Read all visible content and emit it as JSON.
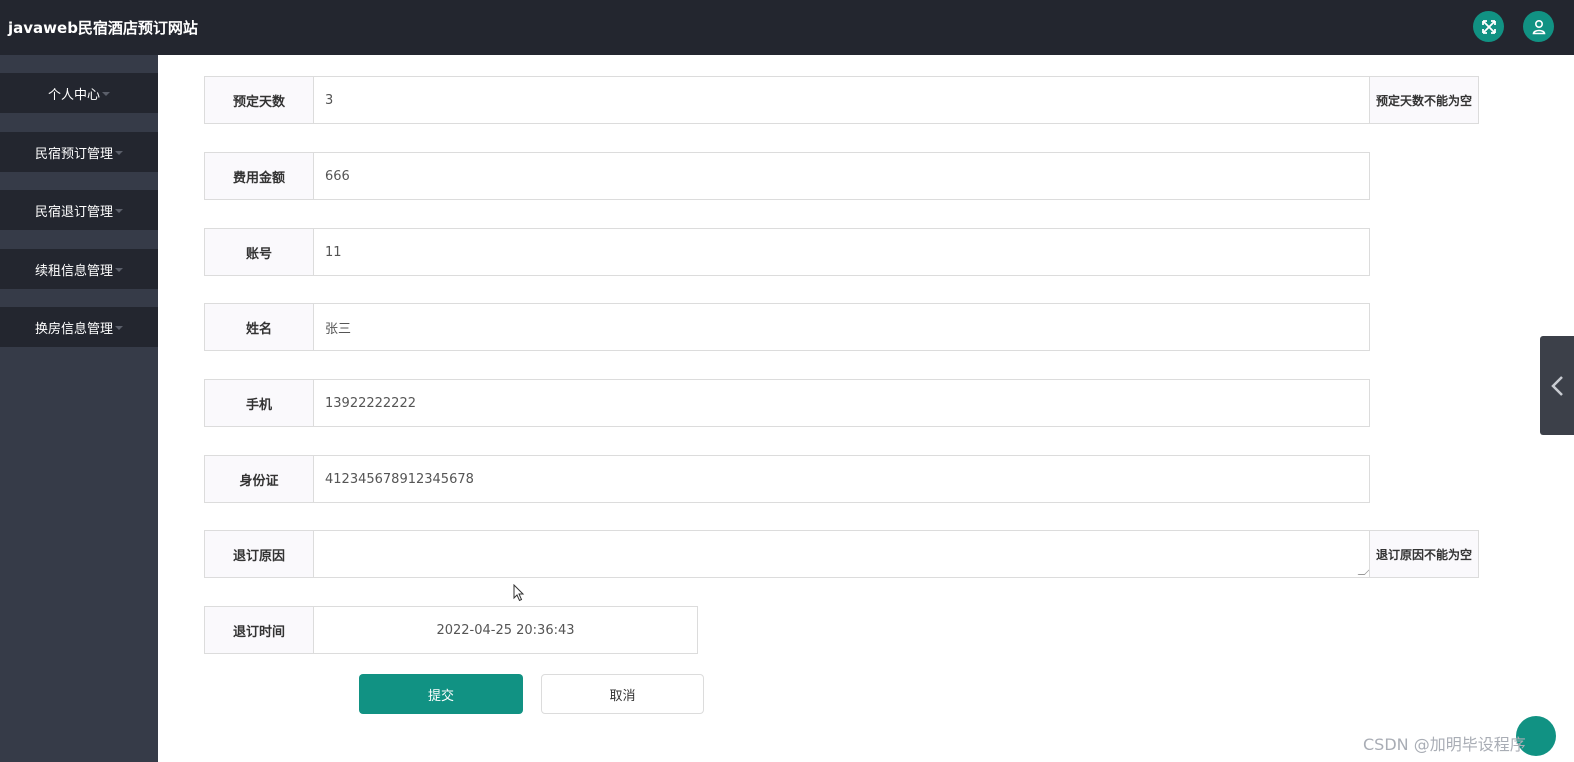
{
  "header": {
    "title": "javaweb民宿酒店预订网站",
    "fullscreen_icon": "fullscreen-icon",
    "user_icon": "user-icon"
  },
  "sidebar": {
    "items": [
      {
        "label": "个人中心"
      },
      {
        "label": "民宿预订管理"
      },
      {
        "label": "民宿退订管理"
      },
      {
        "label": "续租信息管理"
      },
      {
        "label": "换房信息管理"
      }
    ]
  },
  "form": {
    "days": {
      "label": "预定天数",
      "value": "3",
      "hint": "预定天数不能为空"
    },
    "amount": {
      "label": "费用金额",
      "value": "666"
    },
    "account": {
      "label": "账号",
      "value": "11"
    },
    "name": {
      "label": "姓名",
      "value": "张三"
    },
    "phone": {
      "label": "手机",
      "value": "13922222222"
    },
    "id_card": {
      "label": "身份证",
      "value": "412345678912345678"
    },
    "reason": {
      "label": "退订原因",
      "value": "",
      "hint": "退订原因不能为空"
    },
    "time": {
      "label": "退订时间",
      "value": "2022-04-25 20:36:43"
    }
  },
  "buttons": {
    "submit": "提交",
    "cancel": "取消"
  },
  "watermark": "CSDN @加明毕设程序",
  "colors": {
    "accent": "#119283",
    "topbar": "#23262f",
    "sidebar": "#363b48"
  }
}
